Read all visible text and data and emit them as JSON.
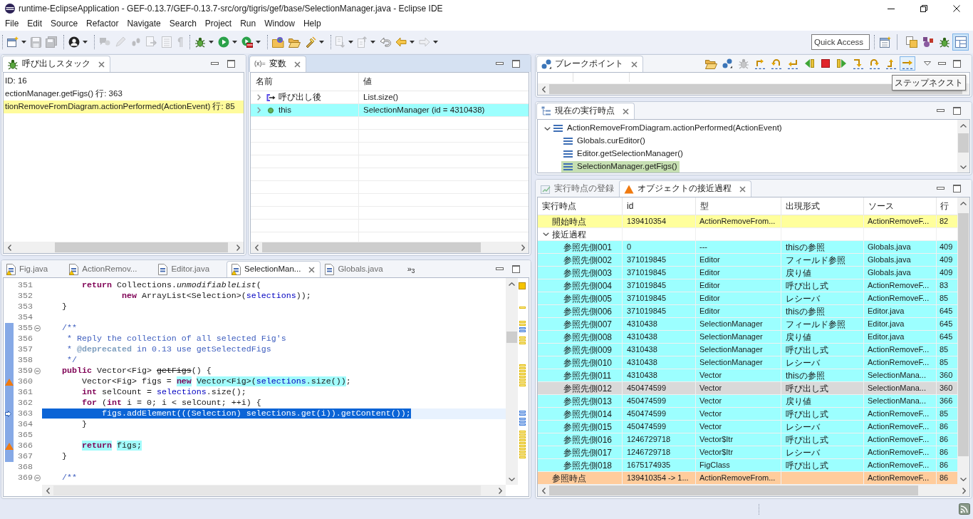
{
  "window": {
    "title": "runtime-EclipseApplication - GEF-0.13.7/GEF-0.13.7-src/org/tigris/gef/base/SelectionManager.java - Eclipse IDE"
  },
  "menu": [
    "File",
    "Edit",
    "Source",
    "Refactor",
    "Navigate",
    "Search",
    "Project",
    "Run",
    "Window",
    "Help"
  ],
  "toolbar": [
    [
      {
        "dropdown": true,
        "disabled": false
      },
      {
        "dropdown": false,
        "disabled": true
      },
      {
        "dropdown": false,
        "disabled": true
      }
    ],
    [
      {
        "dropdown": true,
        "disabled": false
      }
    ],
    [
      {
        "dropdown": false,
        "disabled": true
      },
      {
        "dropdown": false,
        "disabled": true
      },
      {
        "dropdown": false,
        "disabled": true
      },
      {
        "dropdown": false,
        "disabled": true
      },
      {
        "dropdown": false,
        "disabled": true
      },
      {
        "dropdown": false,
        "disabled": true
      }
    ],
    [
      {
        "dropdown": true,
        "disabled": false
      },
      {
        "dropdown": true,
        "disabled": false
      },
      {
        "dropdown": true,
        "disabled": false
      }
    ],
    [
      {
        "dropdown": false,
        "disabled": false
      },
      {
        "dropdown": false,
        "disabled": false
      },
      {
        "dropdown": true,
        "disabled": false
      }
    ],
    [
      {
        "dropdown": true,
        "disabled": true
      },
      {
        "dropdown": true,
        "disabled": true
      },
      {
        "dropdown": false,
        "disabled": false
      },
      {
        "dropdown": true,
        "disabled": false
      },
      {
        "dropdown": true,
        "disabled": true
      }
    ]
  ],
  "quick_access": {
    "placeholder": "Quick Access"
  },
  "perspectives": [
    {
      "selected": false
    },
    {
      "selected": false
    },
    {
      "selected": false
    },
    {
      "selected": true
    }
  ],
  "call_stack": {
    "tab": "呼び出しスタック",
    "active": false,
    "rows": [
      {
        "text": "ID: 16",
        "highlighted": false
      },
      {
        "text": "ectionManager.getFigs() 行: 363",
        "highlighted": false
      },
      {
        "text": "tionRemoveFromDiagram.actionPerformed(ActionEvent) 行: 85",
        "highlighted": true
      }
    ]
  },
  "variables": {
    "tab_icon": "(x)=",
    "tab": "変数",
    "active": true,
    "columns": [
      "名前",
      "値"
    ],
    "rows": [
      {
        "kind": "return",
        "name": "呼び出し後",
        "value": "List.size()",
        "expanded": false,
        "selected": false
      },
      {
        "kind": "field",
        "name": "this",
        "value": "SelectionManager (id = 4310438)",
        "expanded": false,
        "selected": true
      }
    ]
  },
  "editor": {
    "active": false,
    "tabs": [
      {
        "label": "Fig.java",
        "warning": true,
        "selected": false
      },
      {
        "label": "ActionRemov...",
        "warning": true,
        "selected": false
      },
      {
        "label": "Editor.java",
        "warning": false,
        "selected": false
      },
      {
        "label": "SelectionMan...",
        "warning": true,
        "selected": true
      },
      {
        "label": "Globals.java",
        "warning": false,
        "selected": false
      }
    ],
    "overflow": "»$_{3}$",
    "lines": [
      {
        "number": "351",
        "current": false,
        "fold": false,
        "traced": false,
        "marked": false,
        "tokens": [
          {
            "text": "        return",
            "kind": "keyword",
            "highlighted": false
          },
          {
            "text": " Collections.",
            "kind": "plain",
            "highlighted": false
          },
          {
            "text": "unmodifiableList",
            "kind": "static",
            "highlighted": false
          },
          {
            "text": "(",
            "kind": "plain",
            "highlighted": false
          }
        ]
      },
      {
        "number": "352",
        "current": false,
        "fold": false,
        "traced": false,
        "marked": false,
        "tokens": [
          {
            "text": "                new",
            "kind": "keyword",
            "highlighted": false
          },
          {
            "text": " ArrayList<Selection>(",
            "kind": "plain",
            "highlighted": false
          },
          {
            "text": "selections",
            "kind": "field",
            "highlighted": false
          },
          {
            "text": "));",
            "kind": "plain",
            "highlighted": false
          }
        ]
      },
      {
        "number": "353",
        "current": false,
        "fold": false,
        "traced": false,
        "marked": false,
        "tokens": [
          {
            "text": "    }",
            "kind": "plain",
            "highlighted": false
          }
        ]
      },
      {
        "number": "354",
        "current": false,
        "fold": false,
        "traced": false,
        "marked": false
      },
      {
        "number": "355",
        "current": false,
        "fold": true,
        "traced": true,
        "marked": false,
        "tokens": [
          {
            "text": "    /**",
            "kind": "comment",
            "highlighted": false
          }
        ]
      },
      {
        "number": "356",
        "current": false,
        "fold": false,
        "traced": true,
        "marked": false,
        "tokens": [
          {
            "text": "     * Reply the collection of all selected Fig's",
            "kind": "comment",
            "highlighted": false
          }
        ]
      },
      {
        "number": "357",
        "current": false,
        "fold": false,
        "traced": true,
        "marked": false,
        "tokens": [
          {
            "text": "     * ",
            "kind": "comment",
            "highlighted": false
          },
          {
            "text": "@deprecated",
            "kind": "tag",
            "highlighted": false
          },
          {
            "text": " in 0.13 use getSelectedFigs",
            "kind": "comment",
            "highlighted": false
          }
        ]
      },
      {
        "number": "358",
        "current": false,
        "fold": false,
        "traced": true,
        "marked": false,
        "tokens": [
          {
            "text": "     */",
            "kind": "comment",
            "highlighted": false
          }
        ]
      },
      {
        "number": "359",
        "current": false,
        "fold": true,
        "traced": true,
        "marked": false,
        "tokens": [
          {
            "text": "    public",
            "kind": "keyword",
            "highlighted": false
          },
          {
            "text": " Vector<Fig> ",
            "kind": "plain",
            "highlighted": false
          },
          {
            "text": "getFigs",
            "kind": "deprecated",
            "highlighted": false
          },
          {
            "text": "() {",
            "kind": "plain",
            "highlighted": false
          }
        ]
      },
      {
        "number": "360",
        "current": false,
        "fold": false,
        "traced": true,
        "marked": true,
        "tokens": [
          {
            "text": "        Vector<Fig> figs = ",
            "kind": "plain",
            "highlighted": false
          },
          {
            "text": "new",
            "kind": "keyword",
            "highlighted": true
          },
          {
            "text": " Vector<Fig>(",
            "kind": "plain",
            "highlighted": true
          },
          {
            "text": "selections",
            "kind": "field",
            "highlighted": true
          },
          {
            "text": ".size())",
            "kind": "plain",
            "highlighted": true
          },
          {
            "text": ";",
            "kind": "plain",
            "highlighted": false
          }
        ]
      },
      {
        "number": "361",
        "current": false,
        "fold": false,
        "traced": true,
        "marked": false,
        "tokens": [
          {
            "text": "        int",
            "kind": "keyword",
            "highlighted": false
          },
          {
            "text": " selCount = ",
            "kind": "plain",
            "highlighted": false
          },
          {
            "text": "selections",
            "kind": "field",
            "highlighted": false
          },
          {
            "text": ".size();",
            "kind": "plain",
            "highlighted": false
          }
        ]
      },
      {
        "number": "362",
        "current": false,
        "fold": false,
        "traced": true,
        "marked": false,
        "tokens": [
          {
            "text": "        for",
            "kind": "keyword",
            "highlighted": false
          },
          {
            "text": " (",
            "kind": "plain",
            "highlighted": false
          },
          {
            "text": "int",
            "kind": "keyword",
            "highlighted": false
          },
          {
            "text": " i = 0; i < selCount; ++i) {",
            "kind": "plain",
            "highlighted": false
          }
        ]
      },
      {
        "number": "363",
        "current": true,
        "fold": false,
        "traced": true,
        "marked": false,
        "tokens": [
          {
            "text": "            figs.addElement(((Selection) ",
            "kind": "plain",
            "highlighted": false
          },
          {
            "text": "selections",
            "kind": "field",
            "highlighted": false
          },
          {
            "text": ".get(i)).getContent());",
            "kind": "plain",
            "highlighted": false
          }
        ]
      },
      {
        "number": "364",
        "current": false,
        "fold": false,
        "traced": true,
        "marked": false,
        "tokens": [
          {
            "text": "        }",
            "kind": "plain",
            "highlighted": false
          }
        ]
      },
      {
        "number": "365",
        "current": false,
        "fold": false,
        "traced": true,
        "marked": false
      },
      {
        "number": "366",
        "current": false,
        "fold": false,
        "traced": true,
        "marked": true,
        "tokens": [
          {
            "text": "        return",
            "kind": "keyword",
            "highlighted": true
          },
          {
            "text": " figs;",
            "kind": "plain",
            "highlighted": true
          }
        ]
      },
      {
        "number": "367",
        "current": false,
        "fold": false,
        "traced": true,
        "marked": false,
        "tokens": [
          {
            "text": "    }",
            "kind": "plain",
            "highlighted": false
          }
        ]
      },
      {
        "number": "368",
        "current": false,
        "fold": false,
        "traced": false,
        "marked": false
      },
      {
        "number": "369",
        "current": false,
        "fold": true,
        "traced": false,
        "marked": false,
        "tokens": [
          {
            "text": "    /**",
            "kind": "comment",
            "highlighted": false
          }
        ]
      }
    ]
  },
  "breakpoints": {
    "tab": "ブレークポイント",
    "active": false,
    "tools": [
      {
        "disabled": false,
        "hovered": false
      },
      {
        "disabled": false,
        "hovered": false
      },
      {
        "disabled": true,
        "hovered": false
      },
      {
        "disabled": false,
        "hovered": false
      },
      {
        "disabled": false,
        "hovered": false
      },
      {
        "disabled": false,
        "hovered": false
      },
      {
        "disabled": false,
        "hovered": false
      },
      {
        "disabled": false,
        "hovered": false
      },
      {
        "disabled": false,
        "hovered": false
      },
      {
        "disabled": false,
        "hovered": false
      },
      {
        "disabled": false,
        "hovered": false
      },
      {
        "disabled": false,
        "hovered": false
      },
      {
        "disabled": false,
        "hovered": true
      }
    ],
    "tooltip": "ステップネクスト"
  },
  "current_point": {
    "tab": "現在の実行時点",
    "active": false,
    "tree": [
      {
        "label": "ActionRemoveFromDiagram.actionPerformed(ActionEvent)",
        "expanded": true,
        "selected": false,
        "children": [
          {
            "label": "Globals.curEditor()",
            "selected": false
          },
          {
            "label": "Editor.getSelectionManager()",
            "selected": false
          },
          {
            "label": "SelectionManager.getFigs()",
            "selected": true
          }
        ]
      }
    ]
  },
  "object_panel": {
    "active": false,
    "tabs": [
      {
        "label": "実行時点の登録",
        "selected": false
      },
      {
        "label": "オブジェクトの接近過程",
        "selected": true
      }
    ],
    "columns": [
      "実行時点",
      "id",
      "型",
      "出現形式",
      "ソース",
      "行"
    ],
    "rows": [
      {
        "kind": "start",
        "point": "開始時点",
        "id": "139410354",
        "type": "ActionRemoveFrom...",
        "source": "ActionRemoveF...",
        "line": "82",
        "selected": false
      },
      {
        "kind": "group",
        "point": "接近過程",
        "expanded": true,
        "selected": false,
        "children": [
          {
            "kind": "ref",
            "point": "参照先側001",
            "id": "0",
            "type": "---",
            "form": "thisの参照",
            "source": "Globals.java",
            "line": "409",
            "selected": false
          },
          {
            "kind": "ref",
            "point": "参照先側002",
            "id": "371019845",
            "type": "Editor",
            "form": "フィールド参照",
            "source": "Globals.java",
            "line": "409",
            "selected": false
          },
          {
            "kind": "ref",
            "point": "参照先側003",
            "id": "371019845",
            "type": "Editor",
            "form": "戻り値",
            "source": "Globals.java",
            "line": "409",
            "selected": false
          },
          {
            "kind": "ref",
            "point": "参照先側004",
            "id": "371019845",
            "type": "Editor",
            "form": "呼び出し式",
            "source": "ActionRemoveF...",
            "line": "83",
            "selected": false
          },
          {
            "kind": "ref",
            "point": "参照先側005",
            "id": "371019845",
            "type": "Editor",
            "form": "レシーバ",
            "source": "ActionRemoveF...",
            "line": "85",
            "selected": false
          },
          {
            "kind": "ref",
            "point": "参照先側006",
            "id": "371019845",
            "type": "Editor",
            "form": "thisの参照",
            "source": "Editor.java",
            "line": "645",
            "selected": false
          },
          {
            "kind": "ref",
            "point": "参照先側007",
            "id": "4310438",
            "type": "SelectionManager",
            "form": "フィールド参照",
            "source": "Editor.java",
            "line": "645",
            "selected": false
          },
          {
            "kind": "ref",
            "point": "参照先側008",
            "id": "4310438",
            "type": "SelectionManager",
            "form": "戻り値",
            "source": "Editor.java",
            "line": "645",
            "selected": false
          },
          {
            "kind": "ref",
            "point": "参照先側009",
            "id": "4310438",
            "type": "SelectionManager",
            "form": "呼び出し式",
            "source": "ActionRemoveF...",
            "line": "85",
            "selected": false
          },
          {
            "kind": "ref",
            "point": "参照先側010",
            "id": "4310438",
            "type": "SelectionManager",
            "form": "レシーバ",
            "source": "ActionRemoveF...",
            "line": "85",
            "selected": false
          },
          {
            "kind": "ref",
            "point": "参照先側011",
            "id": "4310438",
            "type": "Vector",
            "form": "thisの参照",
            "source": "SelectionMana...",
            "line": "360",
            "selected": false
          },
          {
            "kind": "ref",
            "point": "参照先側012",
            "id": "450474599",
            "type": "Vector",
            "form": "呼び出し式",
            "source": "SelectionMana...",
            "line": "360",
            "selected": true
          },
          {
            "kind": "ref",
            "point": "参照先側013",
            "id": "450474599",
            "type": "Vector",
            "form": "戻り値",
            "source": "SelectionMana...",
            "line": "366",
            "selected": false
          },
          {
            "kind": "ref",
            "point": "参照先側014",
            "id": "450474599",
            "type": "Vector",
            "form": "呼び出し式",
            "source": "ActionRemoveF...",
            "line": "85",
            "selected": false
          },
          {
            "kind": "ref",
            "point": "参照先側015",
            "id": "450474599",
            "type": "Vector",
            "form": "レシーバ",
            "source": "ActionRemoveF...",
            "line": "86",
            "selected": false
          },
          {
            "kind": "ref",
            "point": "参照先側016",
            "id": "1246729718",
            "type": "Vector$Itr",
            "form": "呼び出し式",
            "source": "ActionRemoveF...",
            "line": "86",
            "selected": false
          },
          {
            "kind": "ref",
            "point": "参照先側017",
            "id": "1246729718",
            "type": "Vector$Itr",
            "form": "レシーバ",
            "source": "ActionRemoveF...",
            "line": "86",
            "selected": false
          },
          {
            "kind": "ref",
            "point": "参照先側018",
            "id": "1675174935",
            "type": "FigClass",
            "form": "呼び出し式",
            "source": "ActionRemoveF...",
            "line": "86",
            "selected": false
          }
        ]
      },
      {
        "kind": "end",
        "point": "参照時点",
        "id": "139410354 -> 1...",
        "type": "ActionRemoveFrom...",
        "source": "ActionRemoveF...",
        "line": "86",
        "selected": false
      }
    ]
  }
}
